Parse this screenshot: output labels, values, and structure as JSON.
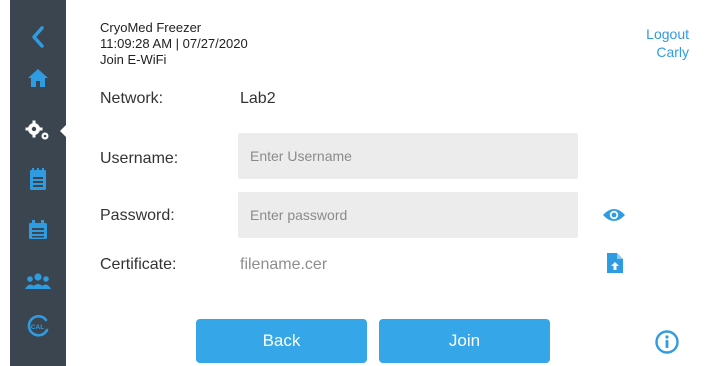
{
  "header": {
    "device_name": "CryoMed Freezer",
    "datetime": "11:09:28 AM | 07/27/2020",
    "page_title": "Join E-WiFi"
  },
  "account": {
    "logout_label": "Logout",
    "user_name": "Carly"
  },
  "sidebar": {
    "items": [
      {
        "icon": "chevron-left-icon"
      },
      {
        "icon": "home-icon"
      },
      {
        "icon": "gears-icon",
        "active": true
      },
      {
        "icon": "clipboard-icon"
      },
      {
        "icon": "calendar-list-icon"
      },
      {
        "icon": "users-icon"
      },
      {
        "icon": "calibration-icon"
      }
    ]
  },
  "form": {
    "network_label": "Network:",
    "network_value": "Lab2",
    "username_label": "Username:",
    "username_placeholder": "Enter Username",
    "username_value": "",
    "password_label": "Password:",
    "password_placeholder": "Enter password",
    "password_value": "",
    "certificate_label": "Certificate:",
    "certificate_value": "filename.cer"
  },
  "actions": {
    "back_label": "Back",
    "join_label": "Join"
  },
  "colors": {
    "sidebar": "#3b4550",
    "accent": "#35a6e8",
    "icon_blue": "#2f9be0",
    "input_bg": "#ececec"
  }
}
